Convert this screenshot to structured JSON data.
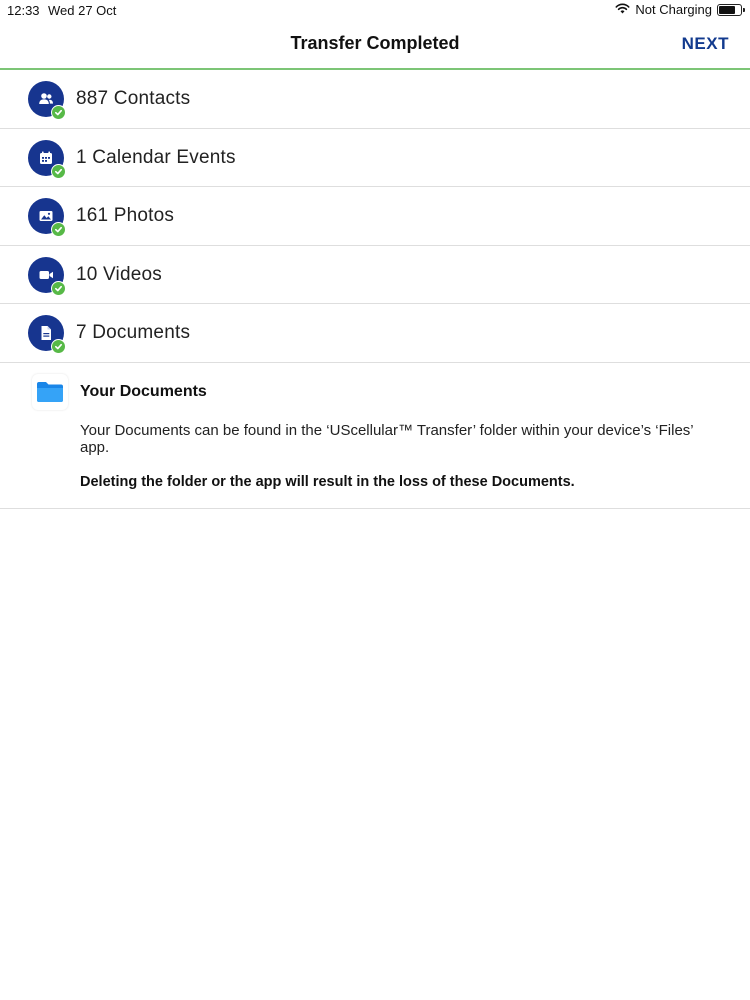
{
  "status_bar": {
    "time": "12:33",
    "date": "Wed 27 Oct",
    "charging": "Not Charging",
    "icons": [
      "wifi-icon",
      "battery-icon"
    ]
  },
  "nav": {
    "title": "Transfer Completed",
    "next_label": "NEXT"
  },
  "colors": {
    "accent_blue": "#17358f",
    "next_blue": "#123a8e",
    "check_green": "#57b947",
    "progress_green": "#7cc576",
    "folder_blue": "#1e8ff0"
  },
  "items": [
    {
      "label": "887 Contacts",
      "icon": "contacts-icon"
    },
    {
      "label": "1 Calendar Events",
      "icon": "calendar-icon"
    },
    {
      "label": "161 Photos",
      "icon": "photo-icon"
    },
    {
      "label": "10 Videos",
      "icon": "video-icon"
    },
    {
      "label": "7 Documents",
      "icon": "document-icon"
    }
  ],
  "documents_info": {
    "icon": "folder-icon",
    "title": "Your Documents",
    "body": "Your Documents can be found in the ‘UScellular™ Transfer’ folder within your device’s ‘Files’ app.",
    "warning": "Deleting the folder or the app will result in the loss of these Documents."
  }
}
